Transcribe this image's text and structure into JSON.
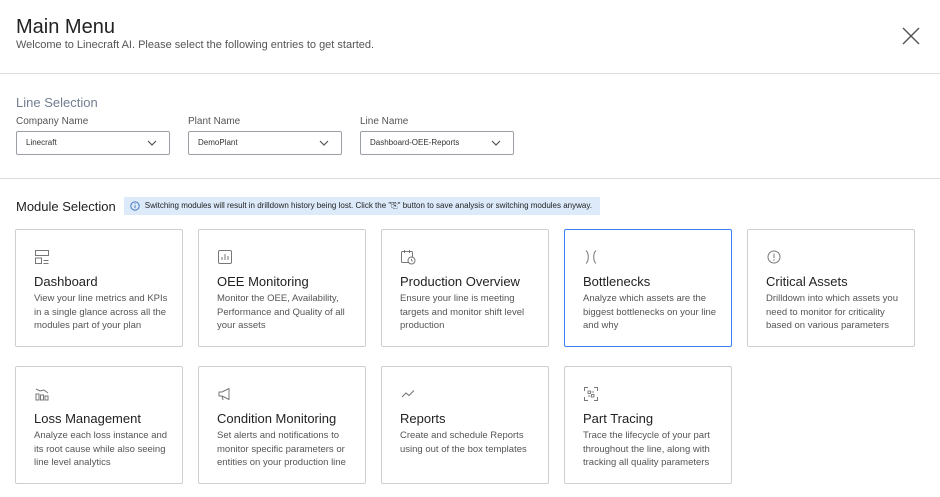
{
  "header": {
    "title": "Main Menu",
    "subtitle": "Welcome to Linecraft AI. Please select the following entries to get started."
  },
  "line_selection": {
    "title": "Line Selection",
    "company": {
      "label": "Company Name",
      "value": "Linecraft"
    },
    "plant": {
      "label": "Plant Name",
      "value": "DemoPlant"
    },
    "line": {
      "label": "Line Name",
      "value": "Dashboard-OEE-Reports"
    }
  },
  "module_selection": {
    "title": "Module Selection",
    "info": "Switching modules will result in drilldown history being lost. Click the \"⎘\" button to save analysis or switching modules anyway.",
    "modules": [
      {
        "title": "Dashboard",
        "desc": "View your line metrics and KPIs in a single glance across all the modules part of your plan",
        "icon": "dashboard-icon"
      },
      {
        "title": "OEE Monitoring",
        "desc": "Monitor the OEE, Availability, Performance and Quality of all your assets",
        "icon": "chart-icon"
      },
      {
        "title": "Production Overview",
        "desc": "Ensure your line is meeting targets and monitor shift level production",
        "icon": "calendar-clock-icon"
      },
      {
        "title": "Bottlenecks",
        "desc": "Analyze which assets are the biggest bottlenecks on your line and why",
        "icon": "bottleneck-icon"
      },
      {
        "title": "Critical Assets",
        "desc": "Drilldown into which assets you need to monitor for criticality based on various parameters",
        "icon": "alert-circle-icon"
      },
      {
        "title": "Loss Management",
        "desc": "Analyze each loss instance and its root cause while also seeing line level analytics",
        "icon": "loss-icon"
      },
      {
        "title": "Condition Monitoring",
        "desc": "Set alerts and notifications to monitor specific parameters or entities on your production line",
        "icon": "megaphone-icon"
      },
      {
        "title": "Reports",
        "desc": "Create and schedule Reports using out of the box templates",
        "icon": "trend-icon"
      },
      {
        "title": "Part Tracing",
        "desc": "Trace the lifecycle of your part throughout the line, along with tracking all quality parameters",
        "icon": "scan-icon"
      }
    ]
  },
  "colors": {
    "selected_border": "#3b82f6",
    "info_bg": "#dceafa"
  }
}
